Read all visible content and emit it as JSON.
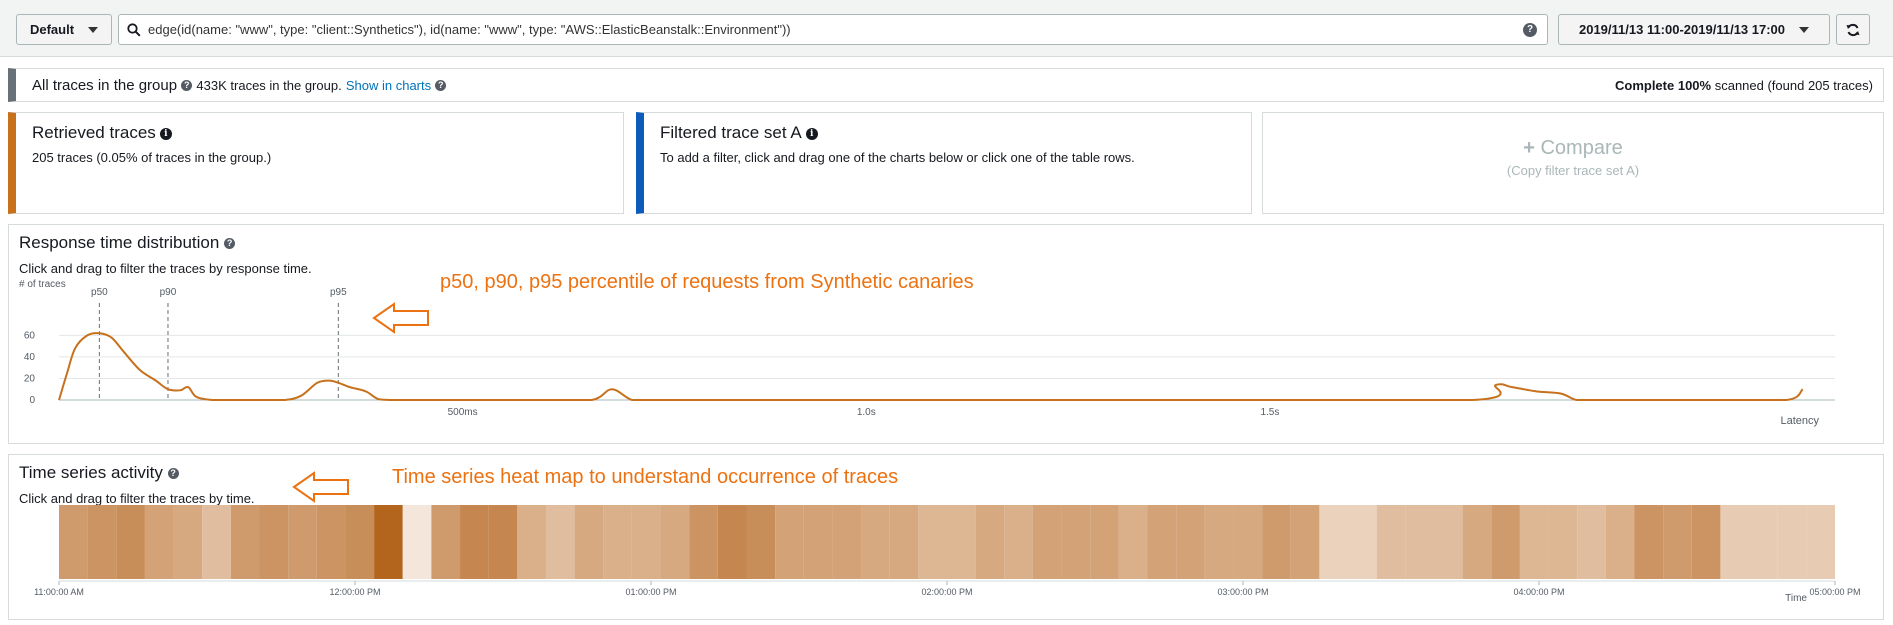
{
  "toolbar": {
    "group_label": "Default",
    "query": "edge(id(name: \"www\", type: \"client::Synthetics\"), id(name: \"www\", type: \"AWS::ElasticBeanstalk::Environment\"))",
    "date_range": "2019/11/13 11:00-2019/11/13 17:00"
  },
  "group": {
    "title": "All traces in the group",
    "count_text": "433K traces in the group.",
    "show_link": "Show in charts",
    "scan_complete_label": "Complete",
    "scan_percent": "100%",
    "scan_text": "scanned (found 205 traces)"
  },
  "cards": {
    "retrieved": {
      "title": "Retrieved traces",
      "sub": "205 traces (0.05% of traces in the group.)",
      "accent": "#c7711c"
    },
    "filtered": {
      "title": "Filtered trace set A",
      "sub": "To add a filter, click and drag one of the charts below or click one of the table rows.",
      "accent": "#0d5bbb"
    },
    "compare": {
      "title": "Compare",
      "sub": "(Copy filter trace set A)"
    }
  },
  "response": {
    "title": "Response time distribution",
    "sub": "Click and drag to filter the traces by response time.",
    "annotation": "p50, p90, p95 percentile of requests from Synthetic  canaries"
  },
  "timeseries": {
    "title": "Time series activity",
    "sub": "Click and drag to filter the traces by time.",
    "annotation": "Time series heat map to understand occurrence of traces"
  },
  "chart_data": [
    {
      "type": "line",
      "ylabel": "# of traces",
      "xlabel": "Latency",
      "yticks": [
        0,
        20,
        40,
        60
      ],
      "ylim": [
        0,
        65
      ],
      "xlim": [
        0,
        2.2
      ],
      "xticks": [
        {
          "value": 0.5,
          "label": "500ms"
        },
        {
          "value": 1.0,
          "label": "1.0s"
        },
        {
          "value": 1.5,
          "label": "1.5s"
        }
      ],
      "percentiles": [
        {
          "label": "p50",
          "value": 0.05
        },
        {
          "label": "p90",
          "value": 0.135
        },
        {
          "label": "p95",
          "value": 0.346
        }
      ],
      "series": [
        {
          "color": "#c7711c",
          "x": [
            0,
            0.01,
            0.02,
            0.035,
            0.05,
            0.065,
            0.08,
            0.1,
            0.12,
            0.135,
            0.15,
            0.16,
            0.17,
            0.19,
            0.22,
            0.25,
            0.28,
            0.3,
            0.32,
            0.335,
            0.346,
            0.36,
            0.38,
            0.395,
            0.41,
            0.44,
            0.6,
            0.66,
            0.685,
            0.71,
            0.74,
            1.0,
            1.4,
            1.75,
            1.78,
            1.8,
            1.83,
            1.86,
            1.88,
            1.9,
            2.05,
            2.14,
            2.16
          ],
          "y": [
            0,
            25,
            48,
            60,
            62,
            58,
            45,
            28,
            18,
            10,
            9,
            12,
            3,
            0,
            0,
            0,
            0,
            4,
            16,
            18,
            16,
            12,
            8,
            1,
            0,
            0,
            0,
            0,
            10,
            0,
            0,
            0,
            0,
            0,
            14,
            12,
            8,
            6,
            0,
            0,
            0,
            0,
            10
          ]
        }
      ]
    },
    {
      "type": "heatmap",
      "xlabel": "Time",
      "xticks": [
        "11:00:00 AM",
        "12:00:00 PM",
        "01:00:00 PM",
        "02:00:00 PM",
        "03:00:00 PM",
        "04:00:00 PM",
        "05:00:00 PM"
      ],
      "color_low": "#f4e6da",
      "color_high": "#b15e13",
      "values": [
        0.55,
        0.6,
        0.65,
        0.5,
        0.45,
        0.3,
        0.55,
        0.6,
        0.55,
        0.6,
        0.65,
        0.95,
        0.0,
        0.55,
        0.7,
        0.7,
        0.4,
        0.3,
        0.45,
        0.4,
        0.4,
        0.45,
        0.6,
        0.7,
        0.65,
        0.5,
        0.5,
        0.5,
        0.45,
        0.45,
        0.35,
        0.35,
        0.45,
        0.4,
        0.5,
        0.5,
        0.5,
        0.4,
        0.5,
        0.5,
        0.45,
        0.45,
        0.55,
        0.5,
        0.15,
        0.15,
        0.3,
        0.3,
        0.3,
        0.45,
        0.55,
        0.35,
        0.35,
        0.3,
        0.4,
        0.6,
        0.55,
        0.6,
        0.2,
        0.2,
        0.2,
        0.2
      ]
    }
  ]
}
